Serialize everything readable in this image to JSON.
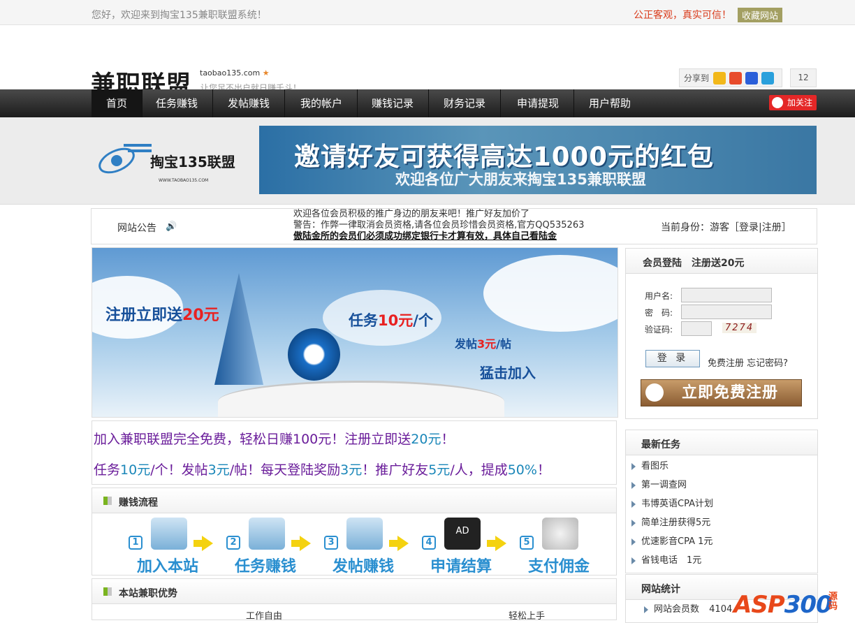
{
  "topbar": {
    "welcome": "您好，欢迎来到掏宝135兼职联盟系统！",
    "slogan": "公正客观，真实可信！",
    "bookmark": "收藏网站"
  },
  "header": {
    "logo": "兼职联盟",
    "domain": "taobao135.com",
    "star": "★",
    "tagline": "让您足不出户就日赚千斗！",
    "share_label": "分享到",
    "share_count": "12",
    "share_icons": [
      "qzone-icon",
      "weibo-icon",
      "baidu-icon",
      "qq-icon"
    ]
  },
  "nav": {
    "items": [
      "首页",
      "任务赚钱",
      "发帖赚钱",
      "我的帐户",
      "赚钱记录",
      "财务记录",
      "申请提现",
      "用户帮助"
    ],
    "follow": "加关注"
  },
  "banner": {
    "logo_text": "掏宝135联盟",
    "logo_url": "WWW.TAOBAO135.COM",
    "headline": "邀请好友可获得高达1000元的红包",
    "subline": "欢迎各位广大朋友来掏宝135兼职联盟"
  },
  "notice": {
    "label": "网站公告",
    "messages": [
      "欢迎各位会员积极的推广身边的朋友来吧！推广好友加价了",
      "警告：作弊一律取消会员资格,请各位会员珍惜会员资格,官方QQ535263",
      "傲陆金所的会员们必须成功绑定银行卡才算有效，具体自己看陆金"
    ],
    "identity_prefix": "当前身份：游客［",
    "login_link": "登录",
    "sep": "|",
    "register_link": "注册",
    "identity_suffix": "］"
  },
  "hero": {
    "reg_prefix": "注册立即送",
    "reg_amount": "20元",
    "task_prefix": "任务",
    "task_amount": "10元",
    "task_suffix": "/个",
    "post_prefix": "发帖",
    "post_amount": "3元",
    "post_suffix": "/帖",
    "cta": "猛击加入"
  },
  "promo": {
    "line1_a": "加入兼职联盟完全免费，轻松日赚100元！注册立即送",
    "line1_b": "20元",
    "line1_c": "！",
    "line2_a": "任务",
    "line2_b": "10元",
    "line2_c": "/个！发帖",
    "line2_d": "3元",
    "line2_e": "/帖！每天登陆奖励",
    "line2_f": "3元",
    "line2_g": "！推广好友",
    "line2_h": "5元",
    "line2_i": "/人，提成",
    "line2_j": "50%",
    "line2_k": "！"
  },
  "flow": {
    "title": "赚钱流程",
    "steps": [
      {
        "num": "1",
        "label": "加入本站"
      },
      {
        "num": "2",
        "label": "任务赚钱"
      },
      {
        "num": "3",
        "label": "发帖赚钱"
      },
      {
        "num": "4",
        "label": "申请结算"
      },
      {
        "num": "5",
        "label": "支付佣金"
      }
    ],
    "ad_label": "AD"
  },
  "advantages": {
    "title": "本站兼职优势",
    "col1": "工作自由",
    "col2": "轻松上手"
  },
  "login": {
    "title": "会员登陆　注册送20元",
    "username_label": "用户名:",
    "password_label": "密　码:",
    "captcha_label": "验证码:",
    "captcha_value": "7274",
    "submit": "登 录",
    "free_register": "免费注册",
    "forgot": "忘记密码?",
    "register_banner": "立即免费注册"
  },
  "tasks": {
    "title": "最新任务",
    "items": [
      "看图乐",
      "第一调查网",
      "韦博英语CPA计划",
      "简单注册获得5元",
      "优速影音CPA 1元",
      "省钱电话　1元"
    ]
  },
  "stats": {
    "title": "网站统计",
    "members_label": "网站会员数",
    "members_value": "4104"
  },
  "watermark": {
    "a": "ASP",
    "b": "300",
    "c": "源码"
  }
}
